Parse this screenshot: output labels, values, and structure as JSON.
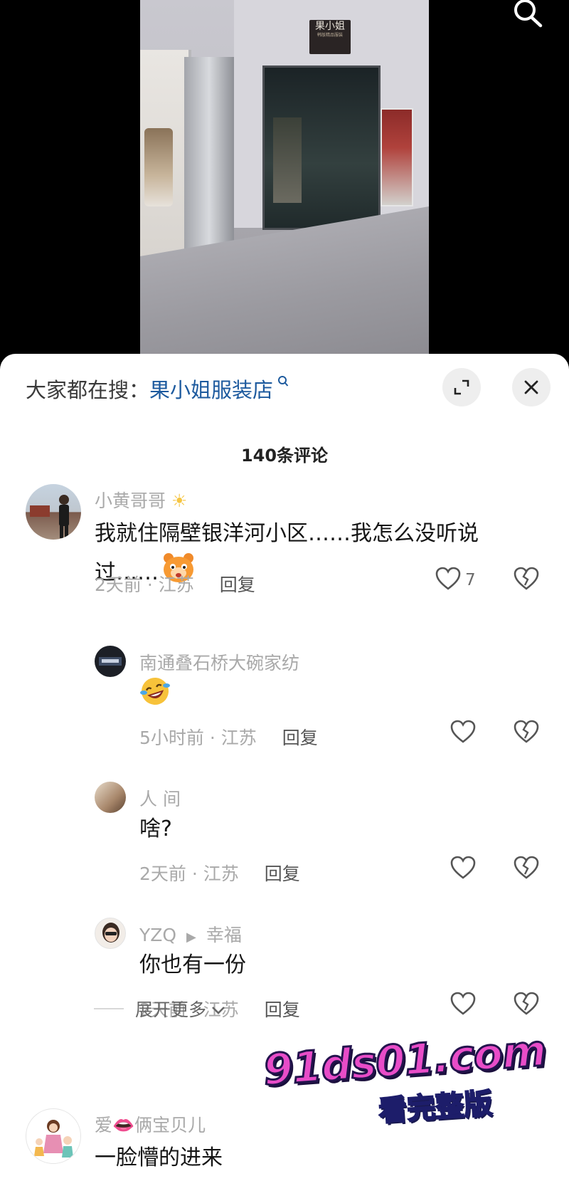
{
  "video": {
    "store_sign": "果小姐",
    "store_sign_sub": "韩版精品服装",
    "search_icon": "search-icon"
  },
  "panel": {
    "hot_search_prefix": "大家都在搜：",
    "hot_search_keyword": "果小姐服装店",
    "hot_search_icon": "magnifier-icon",
    "expand_icon": "expand-icon",
    "close_icon": "close-icon",
    "comment_count": "140条评论"
  },
  "comments": [
    {
      "username": "小黄哥哥",
      "username_emoji": "☀",
      "text_line1": "我就住隔壁银洋河小区……我怎么没听说",
      "text_line2": "过……",
      "emoji": "bear-face-emoji",
      "time": "2天前 · 江苏",
      "reply": "回复",
      "likes": "7"
    },
    {
      "username": "南通叠石桥大碗家纺",
      "text": "",
      "emoji": "laughing-tears-emoji",
      "time": "5小时前 · 江苏",
      "reply": "回复"
    },
    {
      "username": "人 间",
      "text": "啥?",
      "time": "2天前 · 江苏",
      "reply": "回复"
    },
    {
      "username": "YZQ",
      "reply_to": "幸福",
      "text": "你也有一份",
      "time": "2天前 · 江苏",
      "reply": "回复"
    },
    {
      "username": "爱",
      "username_emoji": "👄",
      "username_tail": "俩宝贝儿",
      "text": "一脸懵的进来"
    }
  ],
  "expand_more": "展开更多",
  "watermark": {
    "main": "91ds01.com",
    "sub": "看完整版"
  },
  "colors": {
    "keyword": "#1d5a9e",
    "meta_gray": "#a9a9a9",
    "watermark_pink": "#e84cc8"
  }
}
